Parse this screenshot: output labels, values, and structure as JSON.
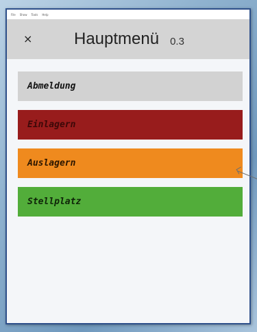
{
  "menubar": {
    "items": [
      "File",
      "Show",
      "Tools",
      "Help"
    ]
  },
  "header": {
    "close_icon": "×",
    "title": "Hauptmenü",
    "version": "0.3"
  },
  "menu": {
    "items": [
      {
        "label": "Abmeldung",
        "color": "#d2d2d2"
      },
      {
        "label": "Einlagern",
        "color": "#981c1c"
      },
      {
        "label": "Auslagern",
        "color": "#ef8a1e"
      },
      {
        "label": "Stellplatz",
        "color": "#52ad3a"
      }
    ]
  }
}
